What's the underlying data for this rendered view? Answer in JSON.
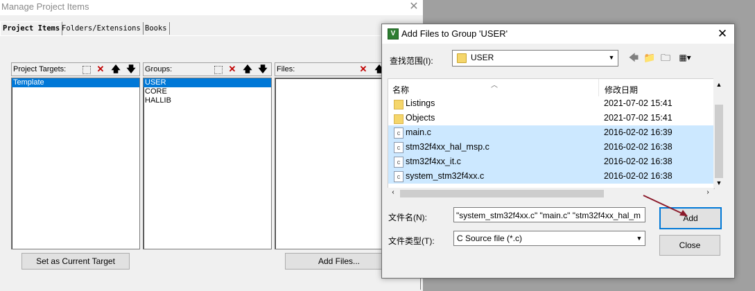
{
  "background_window": {
    "title": "Manage Project Items",
    "tabs": [
      "Project Items",
      "Folders/Extensions",
      "Books"
    ],
    "project_targets": {
      "label": "Project Targets:",
      "items": [
        "Template"
      ],
      "selected": 0
    },
    "groups": {
      "label": "Groups:",
      "items": [
        "USER",
        "CORE",
        "HALLIB"
      ],
      "selected": 0
    },
    "files": {
      "label": "Files:"
    },
    "set_target_button": "Set as Current Target",
    "add_files_button": "Add Files..."
  },
  "dialog": {
    "title": "Add Files to Group 'USER'",
    "icon_text": "V",
    "look_in": {
      "label": "查找范围(I):",
      "value": "USER"
    },
    "columns": {
      "name": "名称",
      "date": "修改日期"
    },
    "files": [
      {
        "name": "Listings",
        "date": "2021-07-02 15:41",
        "type": "folder",
        "selected": false
      },
      {
        "name": "Objects",
        "date": "2021-07-02 15:41",
        "type": "folder",
        "selected": false
      },
      {
        "name": "main.c",
        "date": "2016-02-02 16:39",
        "type": "c-file",
        "selected": true
      },
      {
        "name": "stm32f4xx_hal_msp.c",
        "date": "2016-02-02 16:38",
        "type": "c-file",
        "selected": true
      },
      {
        "name": "stm32f4xx_it.c",
        "date": "2016-02-02 16:38",
        "type": "c-file",
        "selected": true
      },
      {
        "name": "system_stm32f4xx.c",
        "date": "2016-02-02 16:38",
        "type": "c-file",
        "selected": true
      }
    ],
    "filename": {
      "label": "文件名(N):",
      "value": "\"system_stm32f4xx.c\" \"main.c\" \"stm32f4xx_hal_m"
    },
    "filetype": {
      "label": "文件类型(T):",
      "value": "C Source file (*.c)"
    },
    "add_button": "Add",
    "close_button": "Close"
  },
  "colors": {
    "selection_blue": "#0078d7",
    "row_highlight": "#cce8ff",
    "annotation_arrow": "#8b1a2b"
  }
}
